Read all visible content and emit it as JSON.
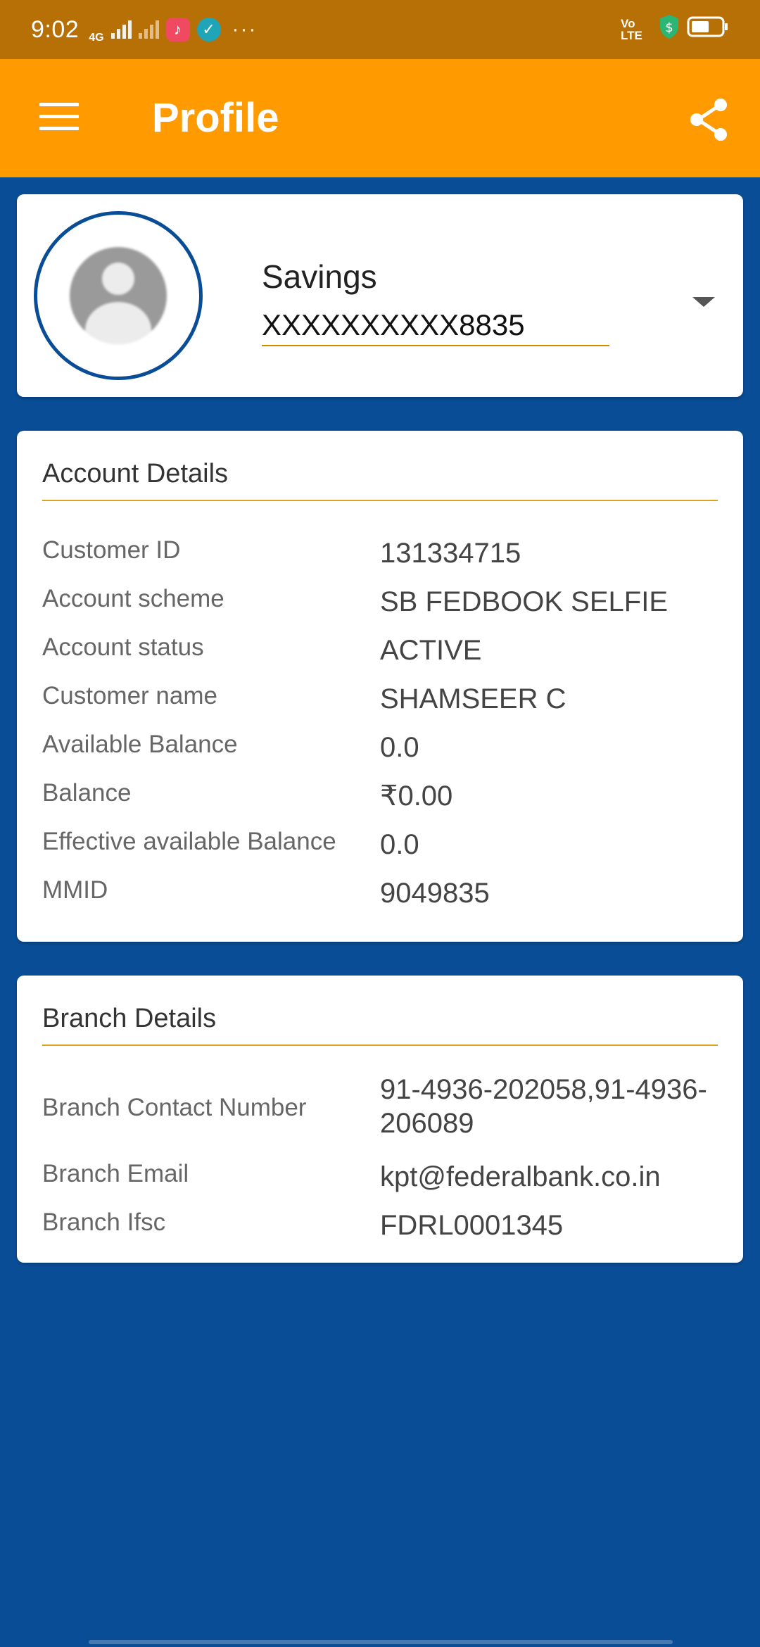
{
  "status_bar": {
    "time": "9:02",
    "network_label": "4G",
    "volte_label": "Vo LTE",
    "overflow": "···",
    "icons": [
      "signal-icon",
      "music-app-icon",
      "check-app-icon",
      "shield-dollar-icon",
      "battery-icon"
    ]
  },
  "app_bar": {
    "title": "Profile",
    "menu_icon": "hamburger-menu-icon",
    "share_icon": "share-icon",
    "color": "#ff9b00"
  },
  "profile": {
    "account_type": "Savings",
    "account_number": "XXXXXXXXXX8835",
    "avatar_icon": "default-avatar-icon"
  },
  "account_details": {
    "title": "Account Details",
    "rows": [
      {
        "label": "Customer ID",
        "value": "131334715"
      },
      {
        "label": "Account scheme",
        "value": "SB FEDBOOK SELFIE"
      },
      {
        "label": "Account status",
        "value": "ACTIVE"
      },
      {
        "label": "Customer name",
        "value": "SHAMSEER C"
      },
      {
        "label": "Available Balance",
        "value": "0.0"
      },
      {
        "label": "Balance",
        "value": "₹0.00"
      },
      {
        "label": "Effective available Balance",
        "value": "0.0"
      },
      {
        "label": "MMID",
        "value": "9049835"
      }
    ]
  },
  "branch_details": {
    "title": "Branch Details",
    "rows": [
      {
        "label": "Branch Contact Number",
        "value": "91-4936-202058,91-4936-206089"
      },
      {
        "label": "Branch Email",
        "value": "kpt@federalbank.co.in"
      },
      {
        "label": "Branch Ifsc",
        "value": "FDRL0001345"
      }
    ]
  },
  "colors": {
    "background": "#0a4d97",
    "accent": "#ff9b00",
    "divider": "#e0a020"
  }
}
